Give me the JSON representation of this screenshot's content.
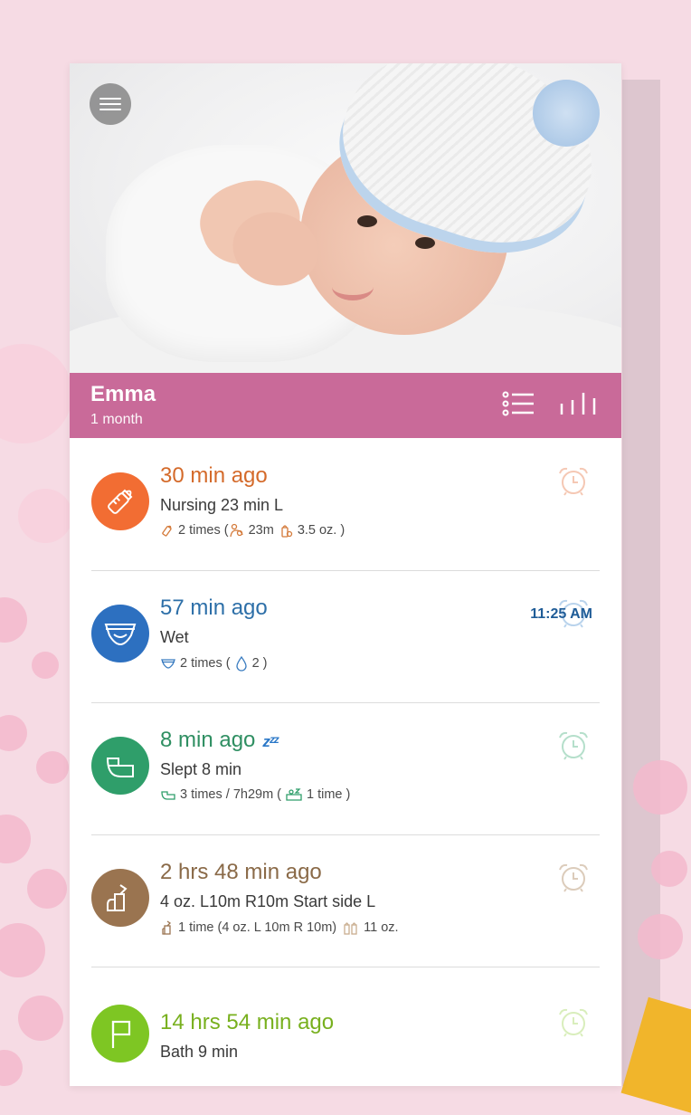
{
  "colors": {
    "background": "#f6dbe4",
    "profile_bar": "#c96a99",
    "nursing": "#f26d33",
    "diaper": "#2d70c0",
    "sleep": "#2f9e6a",
    "pump": "#9a7450",
    "bath": "#7ec623"
  },
  "header": {
    "menu_icon": "hamburger-menu-icon",
    "baby_name": "Emma",
    "baby_age": "1 month",
    "list_view_icon": "list-icon",
    "chart_view_icon": "bar-chart-icon"
  },
  "entries": [
    {
      "type": "nursing",
      "icon": "bottle-icon",
      "ago": "30 min ago",
      "desc": "Nursing 23 min L",
      "stats": {
        "count": "2 times (",
        "dur": "23m",
        "amt": "3.5 oz. )"
      },
      "alarm_icon": "alarm-clock-icon"
    },
    {
      "type": "diaper",
      "icon": "diaper-icon",
      "ago": "57 min ago",
      "desc": "Wet",
      "stats": {
        "count": "2 times (",
        "wet": "2 )"
      },
      "time": "11:25 AM",
      "alarm_icon": "alarm-clock-icon"
    },
    {
      "type": "sleep",
      "icon": "crib-icon",
      "ago": "8 min ago",
      "zzz": "zᶻᶻ",
      "desc": "Slept 8 min",
      "stats": {
        "count": "3 times / 7h29m (",
        "naps": "1 time )"
      },
      "alarm_icon": "alarm-clock-icon"
    },
    {
      "type": "pump",
      "icon": "breast-pump-icon",
      "ago": "2 hrs 48 min ago",
      "desc": "4 oz. L10m R10m  Start side L",
      "stats": {
        "count": "1 time (4 oz.  L 10m R 10m)",
        "total": "11 oz."
      },
      "alarm_icon": "alarm-clock-icon"
    },
    {
      "type": "bath",
      "icon": "flag-icon",
      "ago": "14 hrs 54 min ago",
      "desc": "Bath  9 min",
      "alarm_icon": "alarm-clock-icon"
    }
  ]
}
